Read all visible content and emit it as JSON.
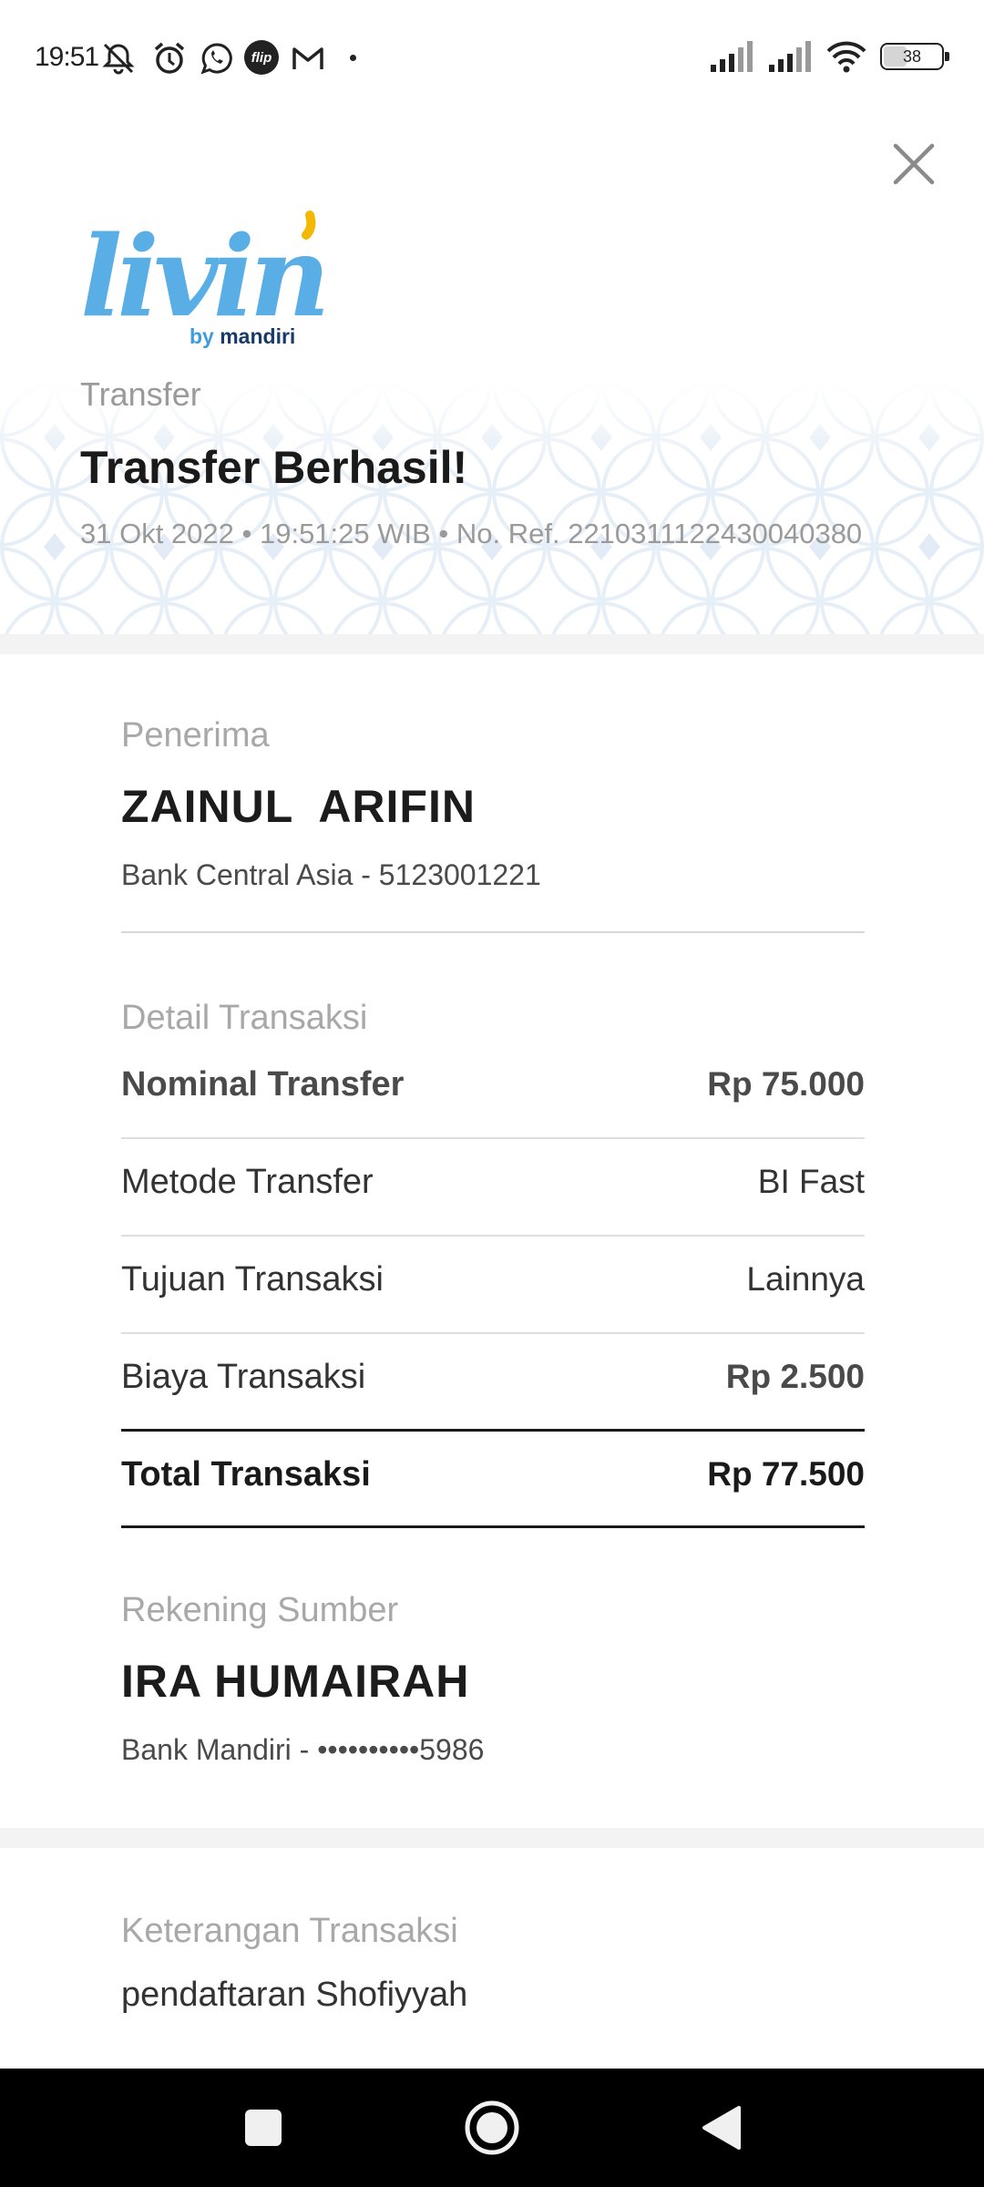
{
  "status_bar": {
    "time": "19:51",
    "battery": "38",
    "icons": [
      "mute-icon",
      "alarm-icon",
      "whatsapp-icon",
      "flip-icon",
      "gmail-icon",
      "dot-icon",
      "signal-icon",
      "signal-icon",
      "wifi-icon",
      "battery-icon"
    ],
    "flip_text": "flip"
  },
  "header": {
    "logo_text": "livin'",
    "logo_by": "by",
    "logo_brand": "mandiri",
    "section": "Transfer",
    "title": "Transfer Berhasil!",
    "meta": "31 Okt 2022 • 19:51:25 WIB • No. Ref. 2210311122430040380"
  },
  "recipient": {
    "label": "Penerima",
    "name": "ZAINUL  ARIFIN",
    "account": "Bank Central Asia - 5123001221"
  },
  "details": {
    "label": "Detail Transaksi",
    "rows": [
      {
        "label": "Nominal Transfer",
        "value": "Rp 75.000"
      },
      {
        "label": "Metode Transfer",
        "value": "BI Fast"
      },
      {
        "label": "Tujuan Transaksi",
        "value": "Lainnya"
      },
      {
        "label": "Biaya Transaksi",
        "value": "Rp 2.500"
      },
      {
        "label": "Total Transaksi",
        "value": "Rp 77.500"
      }
    ]
  },
  "source": {
    "label": "Rekening Sumber",
    "name": "IRA HUMAIRAH",
    "account": "Bank Mandiri - ••••••••••5986"
  },
  "note": {
    "label": "Keterangan Transaksi",
    "text": "pendaftaran Shofiyyah"
  },
  "colors": {
    "logo_blue": "#5aaee6",
    "logo_accent": "#f5b800",
    "brand_navy": "#173a6b",
    "muted": "#9a9a9a"
  }
}
